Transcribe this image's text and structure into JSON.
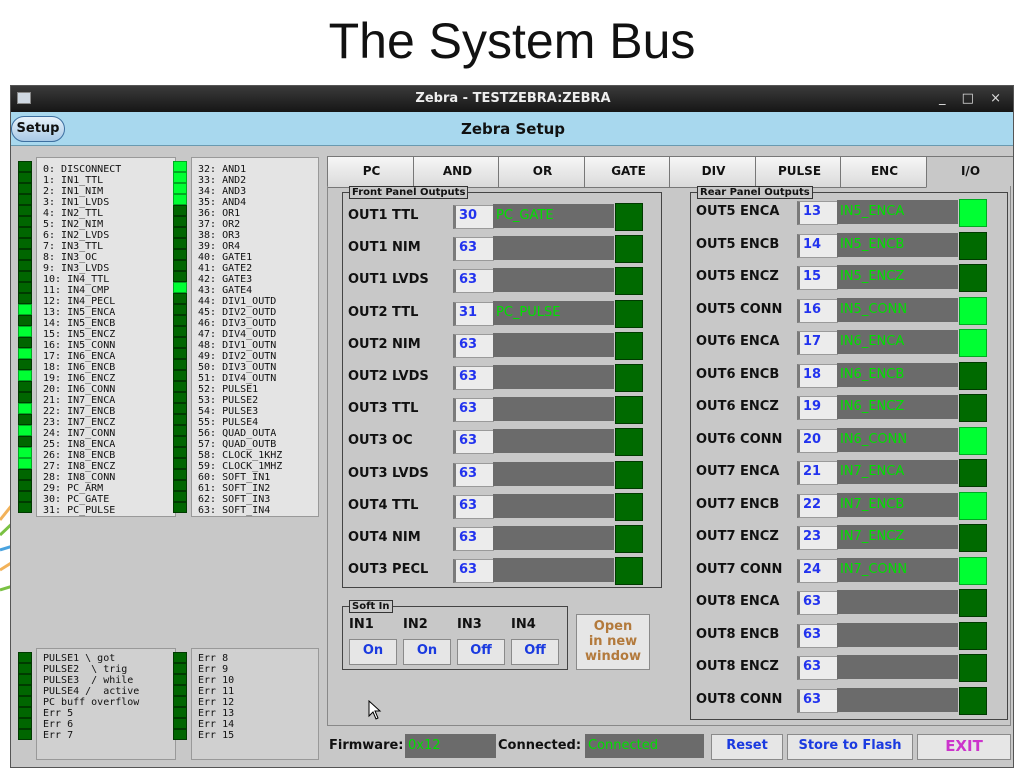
{
  "slide": {
    "title": "The System Bus"
  },
  "window": {
    "title": "Zebra - TESTZEBRA:ZEBRA",
    "controls": "_ □ ×",
    "setup_tab": "Setup",
    "setup_title": "Zebra Setup"
  },
  "bus_list_1": [
    "0: DISCONNECT",
    "1: IN1_TTL",
    "2: IN1_NIM",
    "3: IN1_LVDS",
    "4: IN2_TTL",
    "5: IN2_NIM",
    "6: IN2_LVDS",
    "7: IN3_TTL",
    "8: IN3_OC",
    "9: IN3_LVDS",
    "10: IN4_TTL",
    "11: IN4_CMP",
    "12: IN4_PECL",
    "13: IN5_ENCA",
    "14: IN5_ENCB",
    "15: IN5_ENCZ",
    "16: IN5_CONN",
    "17: IN6_ENCA",
    "18: IN6_ENCB",
    "19: IN6_ENCZ",
    "20: IN6_CONN",
    "21: IN7_ENCA",
    "22: IN7_ENCB",
    "23: IN7_ENCZ",
    "24: IN7_CONN",
    "25: IN8_ENCA",
    "26: IN8_ENCB",
    "27: IN8_ENCZ",
    "28: IN8_CONN",
    "29: PC_ARM",
    "30: PC_GATE",
    "31: PC_PULSE"
  ],
  "bus_list_2": [
    "32: AND1",
    "33: AND2",
    "34: AND3",
    "35: AND4",
    "36: OR1",
    "37: OR2",
    "38: OR3",
    "39: OR4",
    "40: GATE1",
    "41: GATE2",
    "42: GATE3",
    "43: GATE4",
    "44: DIV1_OUTD",
    "45: DIV2_OUTD",
    "46: DIV3_OUTD",
    "47: DIV4_OUTD",
    "48: DIV1_OUTN",
    "49: DIV2_OUTN",
    "50: DIV3_OUTN",
    "51: DIV4_OUTN",
    "52: PULSE1",
    "53: PULSE2",
    "54: PULSE3",
    "55: PULSE4",
    "56: QUAD_OUTA",
    "57: QUAD_OUTB",
    "58: CLOCK_1KHZ",
    "59: CLOCK_1MHZ",
    "60: SOFT_IN1",
    "61: SOFT_IN2",
    "62: SOFT_IN3",
    "63: SOFT_IN4"
  ],
  "bus_leds_1": [
    0,
    0,
    0,
    0,
    0,
    0,
    0,
    0,
    0,
    0,
    0,
    0,
    0,
    1,
    0,
    1,
    0,
    1,
    0,
    1,
    0,
    0,
    1,
    0,
    1,
    0,
    1,
    1,
    0,
    0,
    0,
    0
  ],
  "bus_leds_2": [
    1,
    1,
    1,
    1,
    0,
    0,
    0,
    0,
    0,
    0,
    0,
    1,
    0,
    0,
    0,
    0,
    0,
    0,
    0,
    0,
    0,
    0,
    0,
    0,
    0,
    0,
    0,
    0,
    0,
    0,
    0,
    0
  ],
  "status_list_1": [
    "PULSE1 \\ got",
    "PULSE2  \\ trig",
    "PULSE3  / while",
    "PULSE4 /  active",
    "PC buff overflow",
    "Err 5",
    "Err 6",
    "Err 7"
  ],
  "status_list_2": [
    "Err 8",
    "Err 9",
    "Err 10",
    "Err 11",
    "Err 12",
    "Err 13",
    "Err 14",
    "Err 15"
  ],
  "status_leds_1": [
    0,
    0,
    0,
    0,
    0,
    0,
    0,
    0
  ],
  "status_leds_2": [
    0,
    0,
    0,
    0,
    0,
    0,
    0,
    0
  ],
  "tabs": [
    "PC",
    "AND",
    "OR",
    "GATE",
    "DIV",
    "PULSE",
    "ENC",
    "I/O"
  ],
  "active_tab": "I/O",
  "front_panel": {
    "label": "Front Panel Outputs",
    "rows": [
      {
        "name": "OUT1 TTL",
        "value": "30",
        "signal": "PC_GATE",
        "led": 0
      },
      {
        "name": "OUT1 NIM",
        "value": "63",
        "signal": "",
        "led": 0
      },
      {
        "name": "OUT1 LVDS",
        "value": "63",
        "signal": "",
        "led": 0
      },
      {
        "name": "OUT2 TTL",
        "value": "31",
        "signal": "PC_PULSE",
        "led": 0
      },
      {
        "name": "OUT2 NIM",
        "value": "63",
        "signal": "",
        "led": 0
      },
      {
        "name": "OUT2 LVDS",
        "value": "63",
        "signal": "",
        "led": 0
      },
      {
        "name": "OUT3 TTL",
        "value": "63",
        "signal": "",
        "led": 0
      },
      {
        "name": "OUT3 OC",
        "value": "63",
        "signal": "",
        "led": 0
      },
      {
        "name": "OUT3 LVDS",
        "value": "63",
        "signal": "",
        "led": 0
      },
      {
        "name": "OUT4 TTL",
        "value": "63",
        "signal": "",
        "led": 0
      },
      {
        "name": "OUT4 NIM",
        "value": "63",
        "signal": "",
        "led": 0
      },
      {
        "name": "OUT3 PECL",
        "value": "63",
        "signal": "",
        "led": 0
      }
    ]
  },
  "rear_panel": {
    "label": "Rear Panel Outputs",
    "rows": [
      {
        "name": "OUT5 ENCA",
        "value": "13",
        "signal": "IN5_ENCA",
        "led": 1
      },
      {
        "name": "OUT5 ENCB",
        "value": "14",
        "signal": "IN5_ENCB",
        "led": 0
      },
      {
        "name": "OUT5 ENCZ",
        "value": "15",
        "signal": "IN5_ENCZ",
        "led": 0
      },
      {
        "name": "OUT5 CONN",
        "value": "16",
        "signal": "IN5_CONN",
        "led": 1
      },
      {
        "name": "OUT6 ENCA",
        "value": "17",
        "signal": "IN6_ENCA",
        "led": 1
      },
      {
        "name": "OUT6 ENCB",
        "value": "18",
        "signal": "IN6_ENCB",
        "led": 0
      },
      {
        "name": "OUT6 ENCZ",
        "value": "19",
        "signal": "IN6_ENCZ",
        "led": 0
      },
      {
        "name": "OUT6 CONN",
        "value": "20",
        "signal": "IN6_CONN",
        "led": 1
      },
      {
        "name": "OUT7 ENCA",
        "value": "21",
        "signal": "IN7_ENCA",
        "led": 0
      },
      {
        "name": "OUT7 ENCB",
        "value": "22",
        "signal": "IN7_ENCB",
        "led": 1
      },
      {
        "name": "OUT7 ENCZ",
        "value": "23",
        "signal": "IN7_ENCZ",
        "led": 0
      },
      {
        "name": "OUT7 CONN",
        "value": "24",
        "signal": "IN7_CONN",
        "led": 1
      },
      {
        "name": "OUT8 ENCA",
        "value": "63",
        "signal": "",
        "led": 0
      },
      {
        "name": "OUT8 ENCB",
        "value": "63",
        "signal": "",
        "led": 0
      },
      {
        "name": "OUT8 ENCZ",
        "value": "63",
        "signal": "",
        "led": 0
      },
      {
        "name": "OUT8 CONN",
        "value": "63",
        "signal": "",
        "led": 0
      }
    ]
  },
  "soft_in": {
    "label": "Soft In",
    "inputs": [
      {
        "name": "IN1",
        "state": "On"
      },
      {
        "name": "IN2",
        "state": "On"
      },
      {
        "name": "IN3",
        "state": "Off"
      },
      {
        "name": "IN4",
        "state": "Off"
      }
    ]
  },
  "open_window": {
    "line1": "Open",
    "line2": "in new",
    "line3": "window"
  },
  "footer": {
    "firmware_label": "Firmware:",
    "firmware_value": "0x12",
    "connected_label": "Connected:",
    "connected_value": "Connected",
    "reset": "Reset",
    "store": "Store to Flash",
    "exit": "EXIT"
  },
  "colors": {
    "led_on": "#00ff33",
    "led_off": "#006600",
    "value_text": "#00e000",
    "number_text": "#2233ee",
    "exit_text": "#cc33cc",
    "open_text": "#b37a3c",
    "setup_bar": "#a8d8ee"
  }
}
